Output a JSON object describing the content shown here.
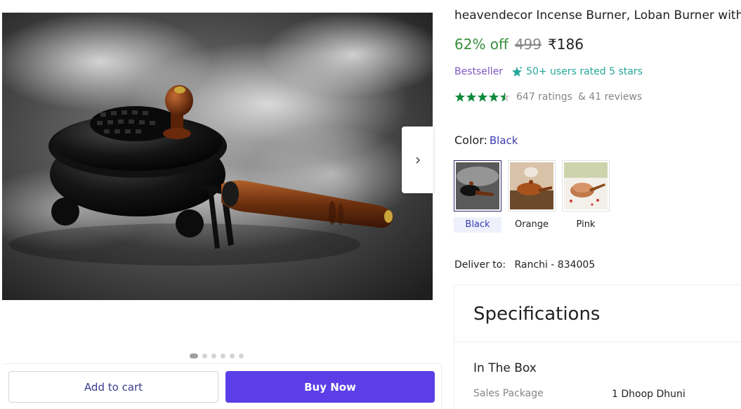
{
  "gallery": {
    "image_alt": "heavendecor Incense Burner black",
    "dots_count": 6,
    "active_dot": 0,
    "add_to_cart_label": "Add to cart",
    "buy_now_label": "Buy Now",
    "next_icon": "chevron-right-icon"
  },
  "product": {
    "title": "heavendecor Incense Burner, Loban Burner with H",
    "discount": "62% off",
    "mrp": "499",
    "price": "₹186",
    "bestseller": "Bestseller",
    "rated_text": "50+ users rated 5 stars",
    "rating_value": 4.5,
    "ratings": "647 ratings",
    "reviews": "& 41 reviews",
    "color_label": "Color:",
    "color_selected": "Black",
    "swatches": [
      {
        "label": "Black"
      },
      {
        "label": "Orange"
      },
      {
        "label": "Pink"
      }
    ],
    "deliver_label": "Deliver to:",
    "deliver_pin": "Ranchi - 834005"
  },
  "specs": {
    "title": "Specifications",
    "section": "In The Box",
    "rows": [
      {
        "key": "Sales Package",
        "value": "1 Dhoop Dhuni"
      }
    ]
  },
  "colors": {
    "primary": "#5b3ee8",
    "discount_green": "#388e3c",
    "star_green": "#0f8a3c",
    "bestseller_purple": "#7e57c2",
    "teal": "#26a69a"
  }
}
